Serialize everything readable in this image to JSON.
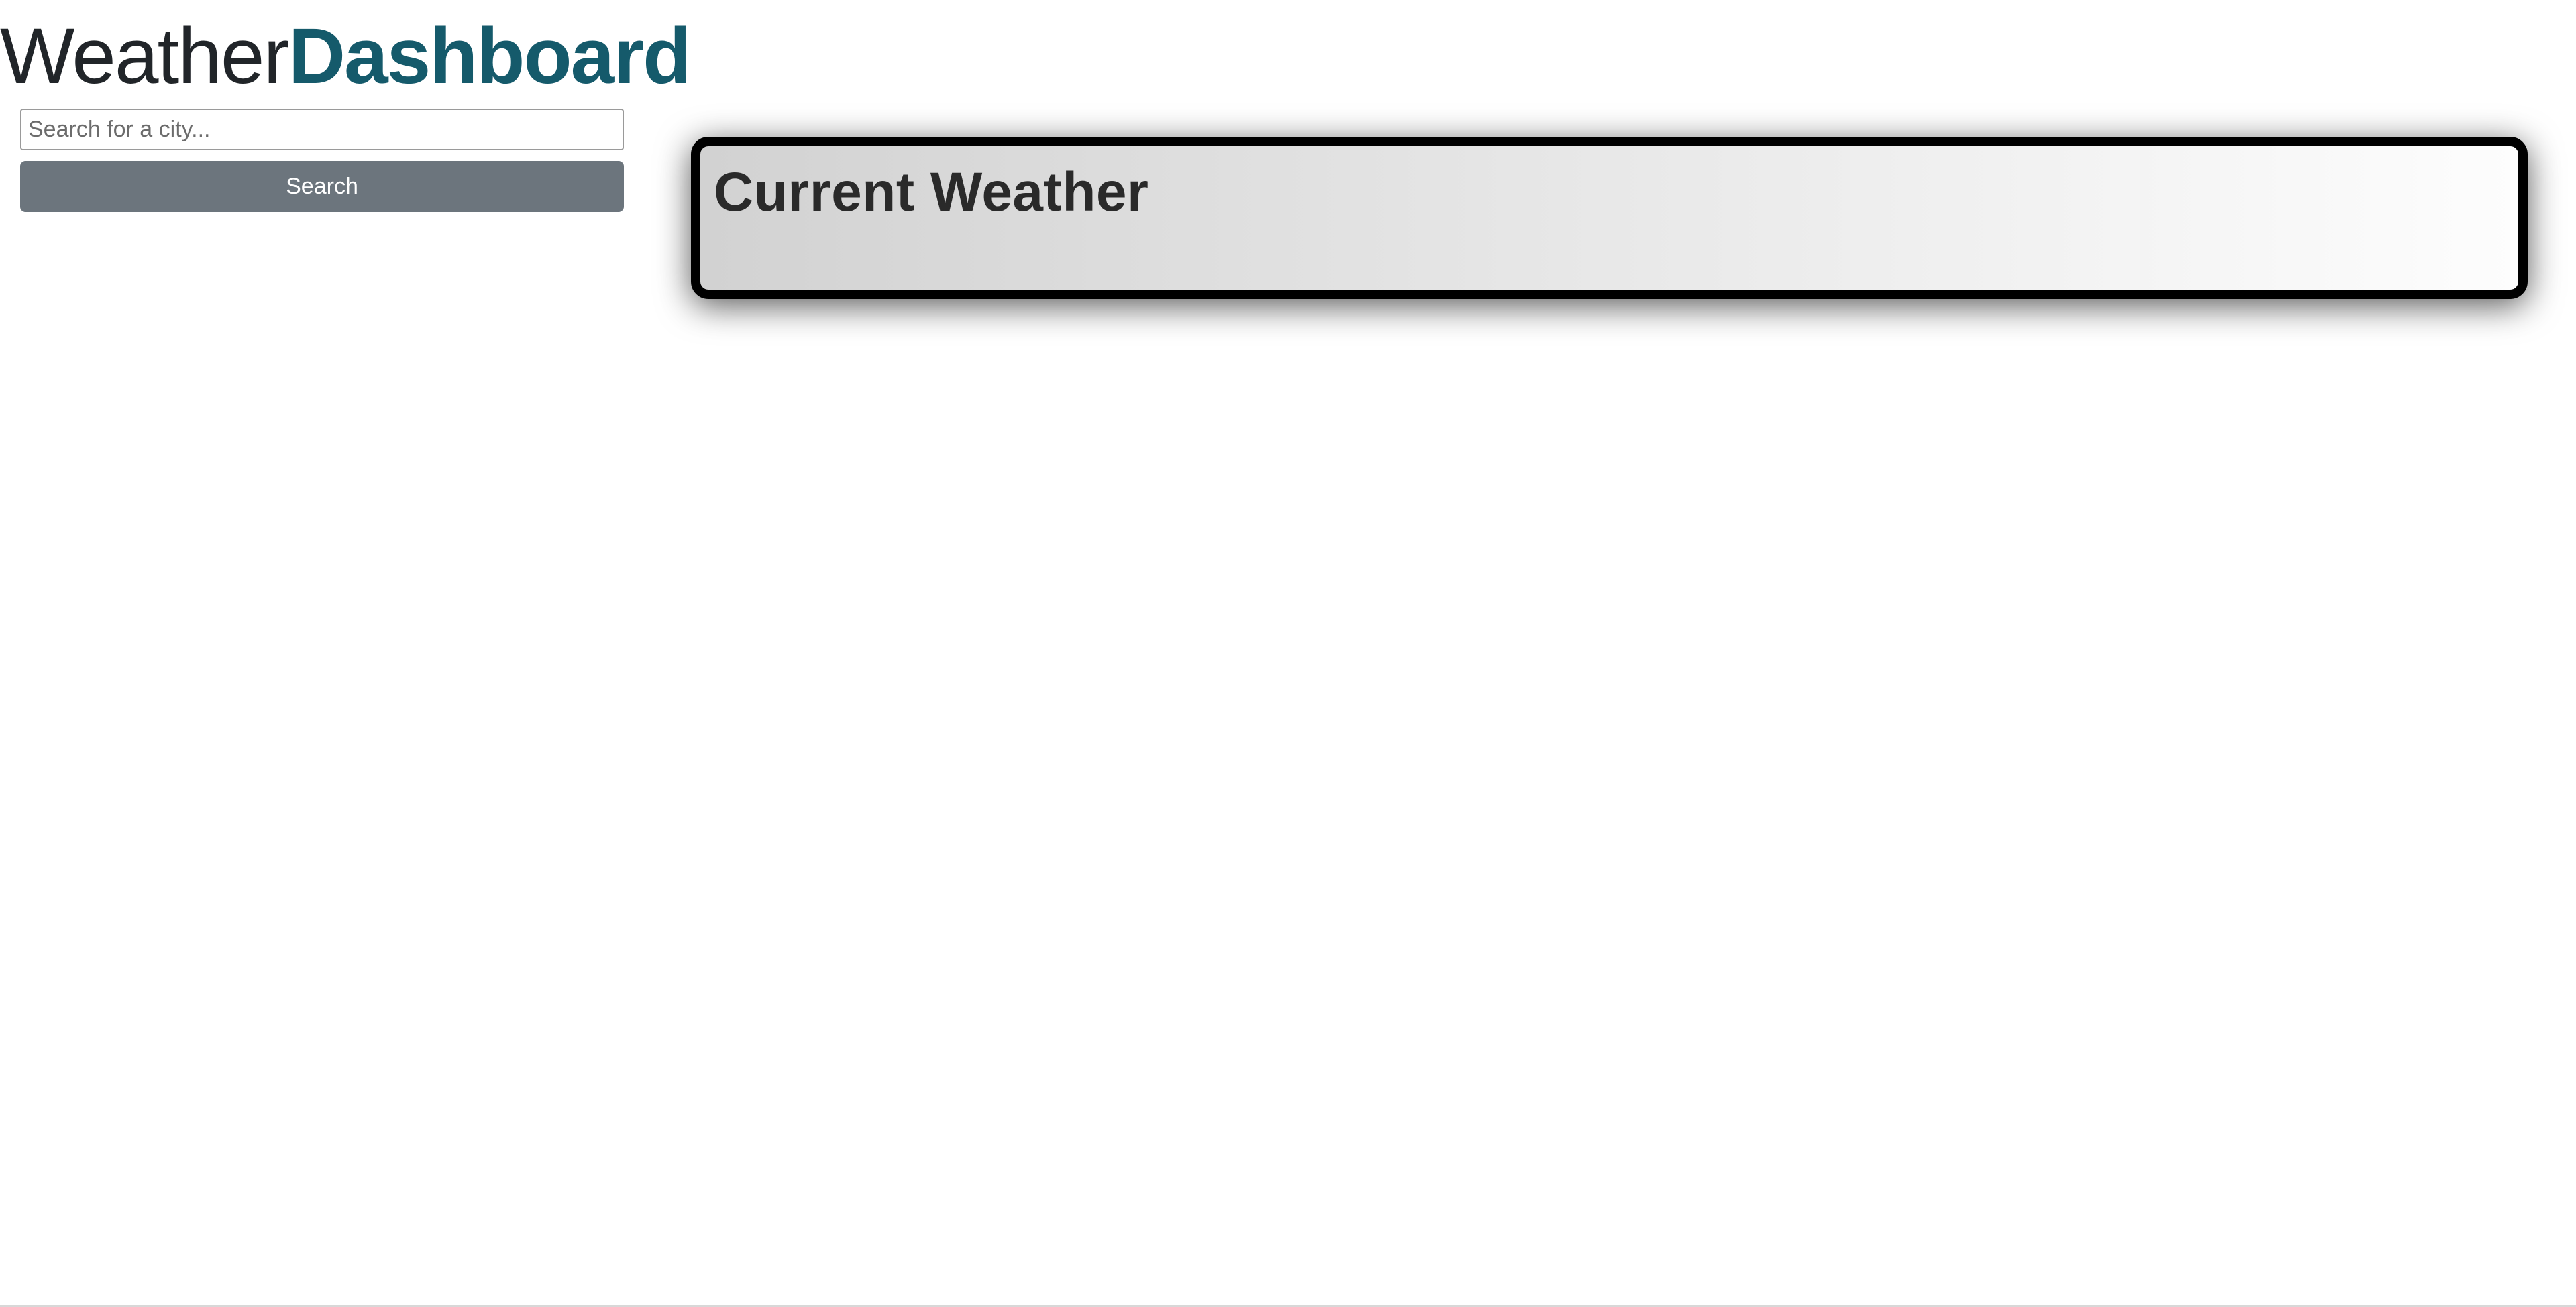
{
  "header": {
    "title_light": "Weather",
    "title_bold": "Dashboard"
  },
  "search": {
    "placeholder": "Search for a city...",
    "value": "",
    "button_label": "Search"
  },
  "current_weather": {
    "heading": "Current Weather"
  },
  "colors": {
    "brand": "#155a6b",
    "button": "#6c757d",
    "card_border": "#000000"
  }
}
